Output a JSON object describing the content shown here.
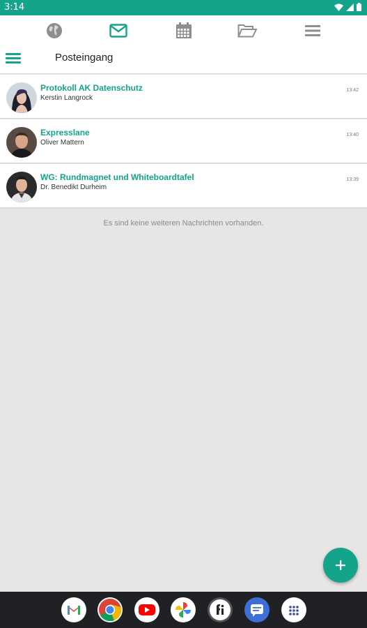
{
  "status_bar": {
    "time": "3:14",
    "icons": [
      "wifi-icon",
      "signal-icon",
      "battery-icon"
    ]
  },
  "top_nav": {
    "items": [
      "globe-icon",
      "mail-icon",
      "calendar-icon",
      "folder-icon",
      "menu-icon"
    ],
    "active": "mail-icon"
  },
  "header": {
    "title": "Posteingang"
  },
  "messages": [
    {
      "subject": "Protokoll AK Datenschutz",
      "sender": "Kerstin Langrock",
      "time": "13:42"
    },
    {
      "subject": "Expresslane",
      "sender": "Oliver Mattern",
      "time": "13:40"
    },
    {
      "subject": "WG: Rundmagnet und Whiteboardtafel",
      "sender": "Dr. Benedikt Durheim",
      "time": "13:39"
    }
  ],
  "empty_text": "Es sind keine weiteren Nachrichten vorhanden.",
  "fab": {
    "icon": "plus-icon"
  },
  "dock": {
    "apps": [
      "gmail-icon",
      "chrome-icon",
      "youtube-icon",
      "photos-icon",
      "fi-icon",
      "messages-icon",
      "app-drawer-icon"
    ]
  },
  "colors": {
    "accent": "#14a38b",
    "background": "#e8e6e5",
    "dock": "#1f2124"
  }
}
